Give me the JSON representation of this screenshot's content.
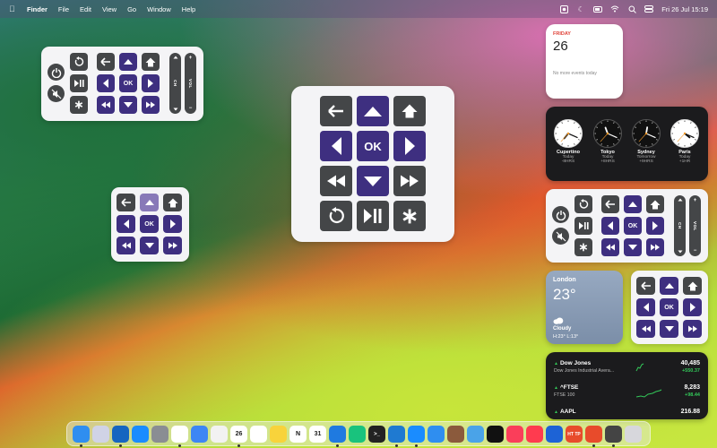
{
  "menubar": {
    "app_name": "Finder",
    "menus": [
      "File",
      "Edit",
      "View",
      "Go",
      "Window",
      "Help"
    ],
    "datetime": "Fri 26 Jul  15:19"
  },
  "remote": {
    "ok_label": "OK",
    "ch_label": "CH",
    "vol_label": "VOL",
    "plus": "+",
    "minus": "−",
    "star": "∗"
  },
  "calendar": {
    "weekday": "FRIDAY",
    "date": "26",
    "events_text": "No more events today"
  },
  "world_clock": [
    {
      "city": "Cupertino",
      "day": "Today",
      "offset": "-8HRS",
      "hour": 7,
      "minute": 19
    },
    {
      "city": "Tokyo",
      "day": "Today",
      "offset": "+8HRS",
      "hour": 23,
      "minute": 19
    },
    {
      "city": "Sydney",
      "day": "Tomorrow",
      "offset": "+9HRS",
      "hour": 0,
      "minute": 19
    },
    {
      "city": "Paris",
      "day": "Today",
      "offset": "+1HR",
      "hour": 16,
      "minute": 19
    }
  ],
  "weather": {
    "city": "London",
    "temp": "23°",
    "condition": "Cloudy",
    "high_low": "H:23° L:13°"
  },
  "stocks": [
    {
      "symbol": "Dow Jones",
      "name": "Dow Jones Industrial Avera...",
      "price": "40,485",
      "change": "+550.37",
      "trend": "up"
    },
    {
      "symbol": "^FTSE",
      "name": "FTSE 100",
      "price": "8,283",
      "change": "+98.44",
      "trend": "up"
    },
    {
      "symbol": "AAPL",
      "name": "",
      "price": "216.88",
      "change": "",
      "trend": "up"
    }
  ],
  "dock": {
    "apps": [
      "finder-icon",
      "launchpad-icon",
      "outlook-icon",
      "app-store-icon",
      "system-settings-icon",
      "slack-icon",
      "keynote-icon",
      "photos-icon",
      "calendar-icon",
      "reminders-icon",
      "notes-icon",
      "notion-icon",
      "fantastical-icon",
      "maps-pin-icon",
      "chatgpt-icon",
      "terminal-icon",
      "vscode-icon",
      "safari-icon",
      "mail-icon",
      "brown-app-icon",
      "preview-icon",
      "apple-tv-icon",
      "music-icon",
      "news-icon",
      "tv-remote-icon",
      "httpie-icon",
      "remote-app-icon",
      "screenshot-icon",
      "trash-icon"
    ],
    "calendar_date": "26",
    "calendar_alt": "31",
    "http_label": "HT TP"
  },
  "colors": {
    "purple": "#3e2f80",
    "dark_button": "#444648"
  }
}
